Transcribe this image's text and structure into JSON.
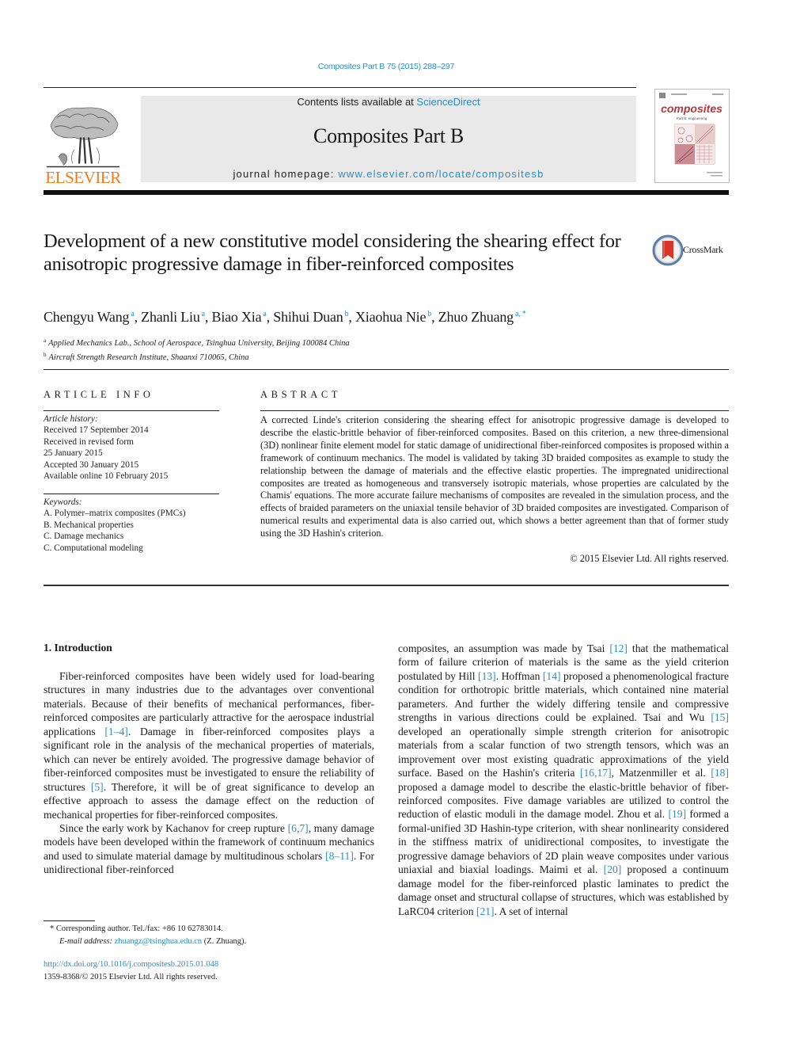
{
  "header": {
    "journal_ref": "Composites Part B 75 (2015) 288–297",
    "publisher_logo_text": "ELSEVIER",
    "contents_prefix": "Contents lists available at ",
    "contents_link": "ScienceDirect",
    "journal_title": "Composites Part B",
    "homepage_prefix": "journal homepage: ",
    "homepage_link": "www.elsevier.com/locate/compositesb",
    "cover_title": "composites",
    "cover_subtitle": "Part B: engineering",
    "colors": {
      "link": "#2a8ec2",
      "elsevier_orange": "#f07b1a",
      "banner_bg": "#e9e9e9",
      "cover_accent": "#b5353b"
    }
  },
  "article": {
    "title": "Development of a new constitutive model considering the shearing effect for anisotropic progressive damage in fiber-reinforced composites",
    "crossmark_label": "CrossMark",
    "authors": [
      {
        "name": "Chengyu Wang",
        "aff": "a"
      },
      {
        "name": "Zhanli Liu",
        "aff": "a"
      },
      {
        "name": "Biao Xia",
        "aff": "a"
      },
      {
        "name": "Shihui Duan",
        "aff": "b"
      },
      {
        "name": "Xiaohua Nie",
        "aff": "b"
      },
      {
        "name": "Zhuo Zhuang",
        "aff": "a, *"
      }
    ],
    "affiliations": [
      {
        "mark": "a",
        "text": "Applied Mechanics Lab., School of Aerospace, Tsinghua University, Beijing 100084 China"
      },
      {
        "mark": "b",
        "text": "Aircraft Strength Research Institute, Shaanxi 710065, China"
      }
    ]
  },
  "article_info": {
    "heading": "ARTICLE INFO",
    "history_label": "Article history:",
    "history": [
      "Received 17 September 2014",
      "Received in revised form",
      "25 January 2015",
      "Accepted 30 January 2015",
      "Available online 10 February 2015"
    ],
    "keywords_label": "Keywords:",
    "keywords": [
      "A. Polymer–matrix composites (PMCs)",
      "B. Mechanical properties",
      "C. Damage mechanics",
      "C. Computational modeling"
    ]
  },
  "abstract": {
    "heading": "ABSTRACT",
    "text": "A corrected Linde's criterion considering the shearing effect for anisotropic progressive damage is developed to describe the elastic-brittle behavior of fiber-reinforced composites. Based on this criterion, a new three-dimensional (3D) nonlinear finite element model for static damage of unidirectional fiber-reinforced composites is proposed within a framework of continuum mechanics. The model is validated by taking 3D braided composites as example to study the relationship between the damage of materials and the effective elastic properties. The impregnated unidirectional composites are treated as homogeneous and transversely isotropic materials, whose properties are calculated by the Chamis' equations. The more accurate failure mechanisms of composites are revealed in the simulation process, and the effects of braided parameters on the uniaxial tensile behavior of 3D braided composites are investigated. Comparison of numerical results and experimental data is also carried out, which shows a better agreement than that of former study using the 3D Hashin's criterion.",
    "copyright": "© 2015 Elsevier Ltd. All rights reserved."
  },
  "body": {
    "section_heading": "1.  Introduction",
    "left": {
      "p1_a": "Fiber-reinforced composites have been widely used for load-bearing structures in many industries due to the advantages over conventional materials. Because of their benefits of mechanical performances, fiber-reinforced composites are particularly attractive for the aerospace industrial applications ",
      "p1_ref1": "[1–4]",
      "p1_b": ". Damage in fiber-reinforced composites plays a significant role in the analysis of the mechanical properties of materials, which can never be entirely avoided. The progressive damage behavior of fiber-reinforced composites must be investigated to ensure the reliability of structures ",
      "p1_ref2": "[5]",
      "p1_c": ". Therefore, it will be of great significance to develop an effective approach to assess the damage effect on the reduction of mechanical properties for fiber-reinforced composites.",
      "p2_a": "Since the early work by Kachanov for creep rupture ",
      "p2_ref1": "[6,7]",
      "p2_b": ", many damage models have been developed within the framework of continuum mechanics and used to simulate material damage by multitudinous scholars ",
      "p2_ref2": "[8–11]",
      "p2_c": ". For unidirectional fiber-reinforced"
    },
    "right": {
      "t1": "composites, an assumption was made by Tsai ",
      "r1": "[12]",
      "t2": " that the mathematical form of failure criterion of materials is the same as the yield criterion postulated by Hill ",
      "r2": "[13]",
      "t3": ". Hoffman ",
      "r3": "[14]",
      "t4": " proposed a phenomenological fracture condition for orthotropic brittle materials, which contained nine material parameters. And further the widely differing tensile and compressive strengths in various directions could be explained. Tsai and Wu ",
      "r4": "[15]",
      "t5": " developed an operationally simple strength criterion for anisotropic materials from a scalar function of two strength tensors, which was an improvement over most existing quadratic approximations of the yield surface. Based on the Hashin's criteria ",
      "r5": "[16,17]",
      "t6": ", Matzenmiller et al. ",
      "r6": "[18]",
      "t7": " proposed a damage model to describe the elastic-brittle behavior of fiber-reinforced composites. Five damage variables are utilized to control the reduction of elastic moduli in the damage model. Zhou et al. ",
      "r7": "[19]",
      "t8": " formed a formal-unified 3D Hashin-type criterion, with shear nonlinearity considered in the stiffness matrix of unidirectional composites, to investigate the progressive damage behaviors of 2D plain weave composites under various uniaxial and biaxial loadings. Maimi et al. ",
      "r8": "[20]",
      "t9": " proposed a continuum damage model for the fiber-reinforced plastic laminates to predict the damage onset and structural collapse of structures, which was established by LaRC04 criterion ",
      "r9": "[21]",
      "t10": ". A set of internal"
    }
  },
  "footnotes": {
    "corresponding": "* Corresponding author. Tel./fax: +86 10 62783014.",
    "email_label": "E-mail address: ",
    "email": "zhuangz@tsinghua.edu.cn",
    "email_suffix": " (Z. Zhuang).",
    "doi": "http://dx.doi.org/10.1016/j.compositesb.2015.01.048",
    "issn_copyright": "1359-8368/© 2015 Elsevier Ltd. All rights reserved."
  }
}
